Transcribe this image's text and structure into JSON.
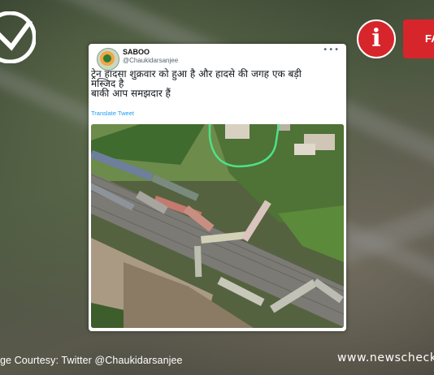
{
  "tweet": {
    "display_name": "SABOO",
    "handle": "@Chaukidarsanjee",
    "more_icon": "more-options-icon",
    "text_lines": [
      "ट्रेन हादसा शुक्रवार को हुआ है और हादसे की जगह एक बड़ी",
      "मस्जिद है",
      "बाकी आप समझदार हैं"
    ],
    "translate_label": "Translate Tweet"
  },
  "badge": {
    "label": "FA"
  },
  "footer": {
    "caption": "ge Courtesy: Twitter @Chaukidarsanjee",
    "site": "www.newscheckc"
  },
  "colors": {
    "brand_red": "#d6262b",
    "link_blue": "#1d9bf0",
    "highlight_green": "#4fe08a"
  }
}
